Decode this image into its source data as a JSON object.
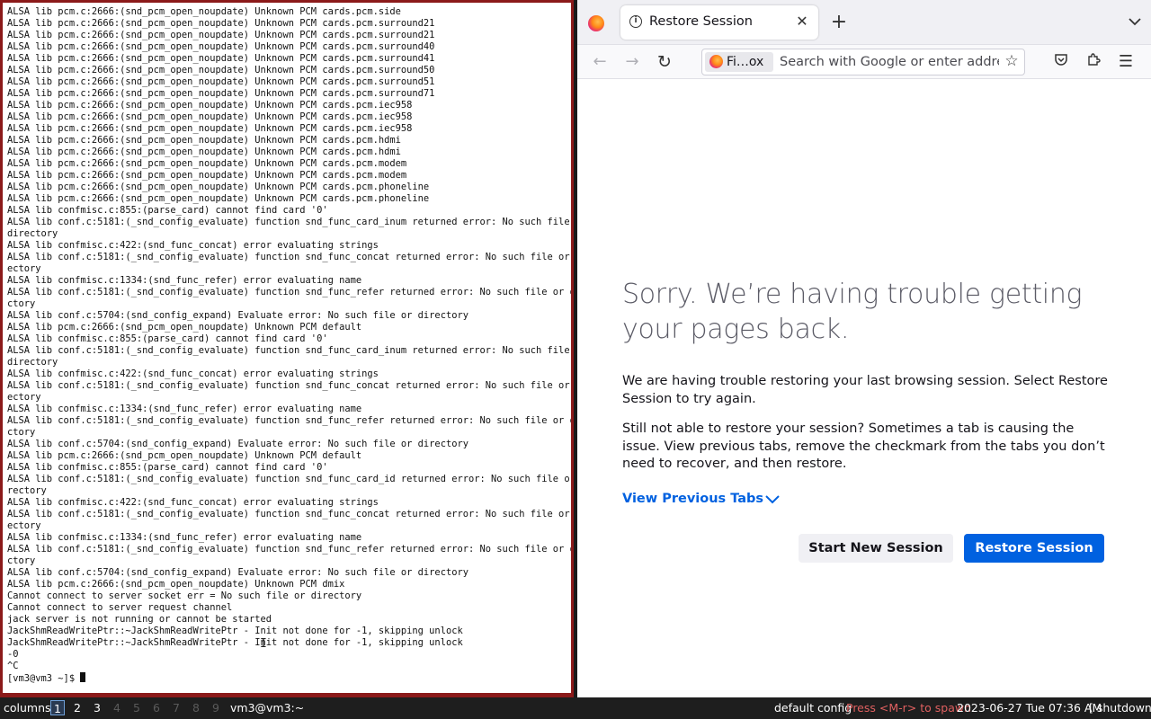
{
  "terminal": {
    "lines": [
      "ALSA lib pcm.c:2666:(snd_pcm_open_noupdate) Unknown PCM cards.pcm.side",
      "ALSA lib pcm.c:2666:(snd_pcm_open_noupdate) Unknown PCM cards.pcm.surround21",
      "ALSA lib pcm.c:2666:(snd_pcm_open_noupdate) Unknown PCM cards.pcm.surround21",
      "ALSA lib pcm.c:2666:(snd_pcm_open_noupdate) Unknown PCM cards.pcm.surround40",
      "ALSA lib pcm.c:2666:(snd_pcm_open_noupdate) Unknown PCM cards.pcm.surround41",
      "ALSA lib pcm.c:2666:(snd_pcm_open_noupdate) Unknown PCM cards.pcm.surround50",
      "ALSA lib pcm.c:2666:(snd_pcm_open_noupdate) Unknown PCM cards.pcm.surround51",
      "ALSA lib pcm.c:2666:(snd_pcm_open_noupdate) Unknown PCM cards.pcm.surround71",
      "ALSA lib pcm.c:2666:(snd_pcm_open_noupdate) Unknown PCM cards.pcm.iec958",
      "ALSA lib pcm.c:2666:(snd_pcm_open_noupdate) Unknown PCM cards.pcm.iec958",
      "ALSA lib pcm.c:2666:(snd_pcm_open_noupdate) Unknown PCM cards.pcm.iec958",
      "ALSA lib pcm.c:2666:(snd_pcm_open_noupdate) Unknown PCM cards.pcm.hdmi",
      "ALSA lib pcm.c:2666:(snd_pcm_open_noupdate) Unknown PCM cards.pcm.hdmi",
      "ALSA lib pcm.c:2666:(snd_pcm_open_noupdate) Unknown PCM cards.pcm.modem",
      "ALSA lib pcm.c:2666:(snd_pcm_open_noupdate) Unknown PCM cards.pcm.modem",
      "ALSA lib pcm.c:2666:(snd_pcm_open_noupdate) Unknown PCM cards.pcm.phoneline",
      "ALSA lib pcm.c:2666:(snd_pcm_open_noupdate) Unknown PCM cards.pcm.phoneline",
      "ALSA lib confmisc.c:855:(parse_card) cannot find card '0'",
      "ALSA lib conf.c:5181:(_snd_config_evaluate) function snd_func_card_inum returned error: No such file or",
      "directory",
      "ALSA lib confmisc.c:422:(snd_func_concat) error evaluating strings",
      "ALSA lib conf.c:5181:(_snd_config_evaluate) function snd_func_concat returned error: No such file or dir",
      "ectory",
      "ALSA lib confmisc.c:1334:(snd_func_refer) error evaluating name",
      "ALSA lib conf.c:5181:(_snd_config_evaluate) function snd_func_refer returned error: No such file or dire",
      "ctory",
      "ALSA lib conf.c:5704:(snd_config_expand) Evaluate error: No such file or directory",
      "ALSA lib pcm.c:2666:(snd_pcm_open_noupdate) Unknown PCM default",
      "ALSA lib confmisc.c:855:(parse_card) cannot find card '0'",
      "ALSA lib conf.c:5181:(_snd_config_evaluate) function snd_func_card_inum returned error: No such file or",
      "directory",
      "ALSA lib confmisc.c:422:(snd_func_concat) error evaluating strings",
      "ALSA lib conf.c:5181:(_snd_config_evaluate) function snd_func_concat returned error: No such file or dir",
      "ectory",
      "ALSA lib confmisc.c:1334:(snd_func_refer) error evaluating name",
      "ALSA lib conf.c:5181:(_snd_config_evaluate) function snd_func_refer returned error: No such file or dire",
      "ctory",
      "ALSA lib conf.c:5704:(snd_config_expand) Evaluate error: No such file or directory",
      "ALSA lib pcm.c:2666:(snd_pcm_open_noupdate) Unknown PCM default",
      "ALSA lib confmisc.c:855:(parse_card) cannot find card '0'",
      "ALSA lib conf.c:5181:(_snd_config_evaluate) function snd_func_card_id returned error: No such file or di",
      "rectory",
      "ALSA lib confmisc.c:422:(snd_func_concat) error evaluating strings",
      "ALSA lib conf.c:5181:(_snd_config_evaluate) function snd_func_concat returned error: No such file or dir",
      "ectory",
      "ALSA lib confmisc.c:1334:(snd_func_refer) error evaluating name",
      "ALSA lib conf.c:5181:(_snd_config_evaluate) function snd_func_refer returned error: No such file or dire",
      "ctory",
      "ALSA lib conf.c:5704:(snd_config_expand) Evaluate error: No such file or directory",
      "ALSA lib pcm.c:2666:(snd_pcm_open_noupdate) Unknown PCM dmix",
      "Cannot connect to server socket err = No such file or directory",
      "Cannot connect to server request channel",
      "jack server is not running or cannot be started",
      "JackShmReadWritePtr::~JackShmReadWritePtr - Init not done for -1, skipping unlock",
      "JackShmReadWritePtr::~JackShmReadWritePtr - Init not done for -1, skipping unlock",
      "-0",
      "^C"
    ],
    "prompt": "[vm3@vm3 ~]$ "
  },
  "browser": {
    "tab": {
      "title": "Restore Session"
    },
    "identity_label": "Fi…ox",
    "url_placeholder": "Search with Google or enter address",
    "error": {
      "title": "Sorry. We’re having trouble getting your pages back.",
      "para1": "We are having trouble restoring your last browsing session. Select Restore Session to try again.",
      "para2": "Still not able to restore your session? Sometimes a tab is causing the issue. View previous tabs, remove the checkmark from the tabs you don’t need to recover, and then restore.",
      "view_tabs": "View Previous Tabs",
      "start_new": "Start New Session",
      "restore": "Restore Session"
    },
    "colors": {
      "accent": "#0061e0",
      "title_gray": "#5b5b66"
    }
  },
  "statusbar": {
    "layout": "columns",
    "workspaces": [
      "1",
      "2",
      "3",
      "4",
      "5",
      "6",
      "7",
      "8",
      "9"
    ],
    "active_workspace": "1",
    "window_title": "vm3@vm3:~",
    "config": "default config",
    "spawn_hint": "Press <M-r> to spawn",
    "clock": "2023-06-27 Tue 07:36 AM",
    "shutdown": "[ shutdown ]"
  }
}
